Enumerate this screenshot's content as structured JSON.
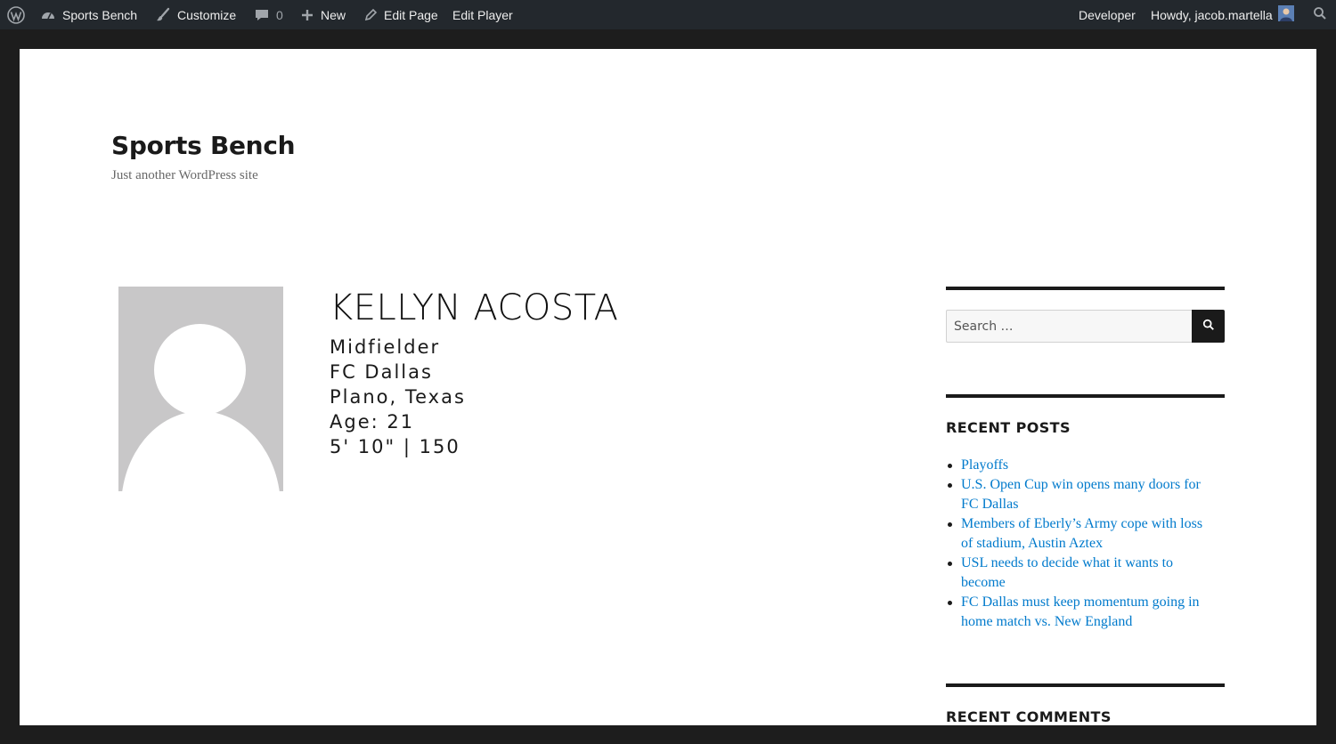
{
  "adminbar": {
    "site_name": "Sports Bench",
    "customize": "Customize",
    "comments_count": "0",
    "new": "New",
    "edit_page": "Edit Page",
    "edit_player": "Edit Player",
    "developer": "Developer",
    "howdy": "Howdy, jacob.martella"
  },
  "site": {
    "title": "Sports Bench",
    "description": "Just another WordPress site"
  },
  "player": {
    "name": "KELLYN ACOSTA",
    "position": "Midfielder",
    "team": "FC Dallas",
    "hometown": "Plano, Texas",
    "age": "Age: 21",
    "size": "5' 10\" | 150"
  },
  "sidebar": {
    "search_placeholder": "Search …",
    "recent_posts_title": "RECENT POSTS",
    "recent_posts": [
      {
        "line1": "Playoffs",
        "line2": ""
      },
      {
        "line1": "U.S. Open Cup win opens many doors for",
        "line2": "FC Dallas"
      },
      {
        "line1": "Members of Eberly’s Army cope with loss",
        "line2": "of stadium, Austin Aztex"
      },
      {
        "line1": "USL needs to decide what it wants to",
        "line2": "become"
      },
      {
        "line1": "FC Dallas must keep momentum going in",
        "line2": "home match vs. New England"
      }
    ],
    "recent_comments_title": "RECENT COMMENTS"
  },
  "colors": {
    "adminbar_bg": "#23282d",
    "link": "#007acc",
    "frame": "#1d1d1d"
  }
}
